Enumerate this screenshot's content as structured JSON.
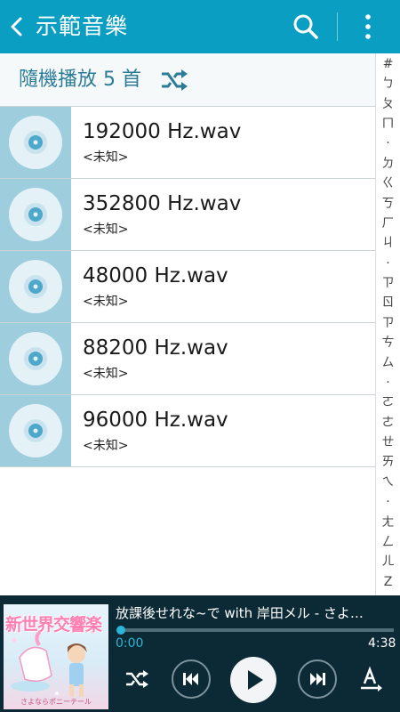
{
  "header": {
    "title": "示範音樂"
  },
  "shuffle": {
    "label": "隨機播放 5 首"
  },
  "tracks": [
    {
      "title": "192000 Hz.wav",
      "artist": "<未知>"
    },
    {
      "title": "352800 Hz.wav",
      "artist": "<未知>"
    },
    {
      "title": "48000 Hz.wav",
      "artist": "<未知>"
    },
    {
      "title": "88200 Hz.wav",
      "artist": "<未知>"
    },
    {
      "title": "96000 Hz.wav",
      "artist": "<未知>"
    }
  ],
  "index": [
    "#",
    "ㄅ",
    "ㄆ",
    "ㄇ",
    "·",
    "ㄉ",
    "ㄍ",
    "ㄎ",
    "ㄏ",
    "ㄐ",
    "·",
    "ㄗ",
    "ㄖ",
    "ㄗ",
    "ㄘ",
    "ㄙ",
    "·",
    "ㄛ",
    "ㄜ",
    "ㄝ",
    "ㄞ",
    "ㄟ",
    "·",
    "ㄤ",
    "ㄥ",
    "ㄦ",
    "Z"
  ],
  "now_playing": {
    "title": "放課後せれな~で with 岸田メル - さよ…",
    "current_time": "0:00",
    "total_time": "4:38",
    "progress": 0.0,
    "album_art": {
      "title": "新世界交響楽",
      "subtitle": "さよならポニーテール"
    }
  },
  "colors": {
    "appbar": "#0a9fc2",
    "accent": "#29b6d8",
    "player_bg": "#0b2a36",
    "thumb_bg": "#9ecddd"
  }
}
